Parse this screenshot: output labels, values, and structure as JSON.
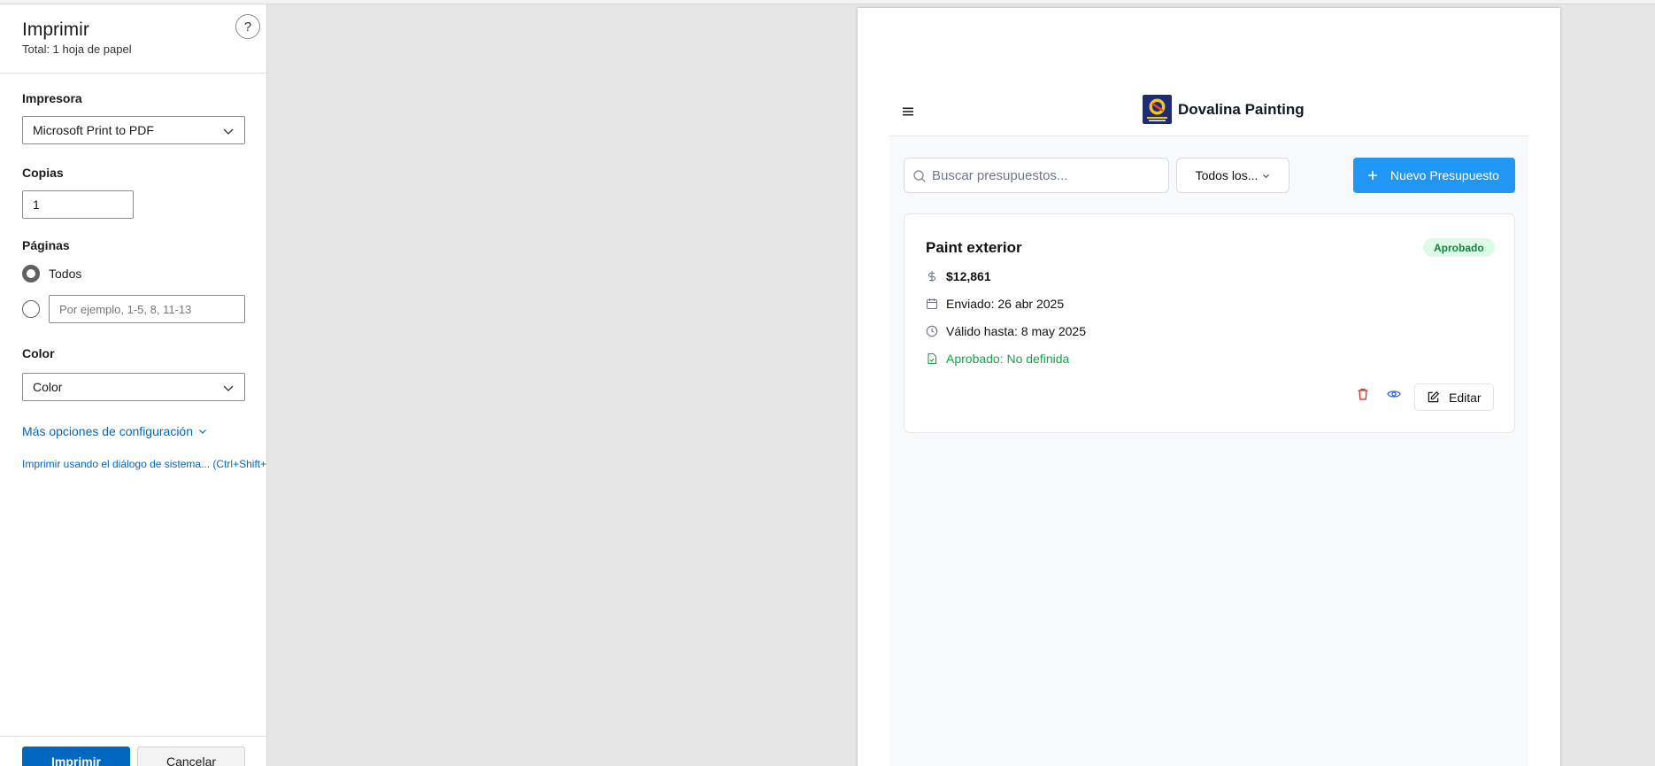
{
  "print_dialog": {
    "title": "Imprimir",
    "subtitle": "Total: 1 hoja de papel",
    "help_label": "?",
    "printer": {
      "label": "Impresora",
      "value": "Microsoft Print to PDF"
    },
    "copies": {
      "label": "Copias",
      "value": "1"
    },
    "pages": {
      "label": "Páginas",
      "option_all": "Todos",
      "range_placeholder": "Por ejemplo, 1-5, 8, 11-13"
    },
    "color": {
      "label": "Color",
      "value": "Color"
    },
    "more_settings": "Más opciones de configuración",
    "system_dialog": "Imprimir usando el diálogo de sistema... (Ctrl+Shift+P)",
    "print_button": "Imprimir",
    "cancel_button": "Cancelar"
  },
  "preview": {
    "brand": "Dovalina Painting",
    "search_placeholder": "Buscar presupuestos...",
    "filter_label": "Todos los...",
    "new_button": "Nuevo Presupuesto",
    "card": {
      "title": "Paint exterior",
      "status": "Aprobado",
      "price": "$12,861",
      "sent": "Enviado: 26 abr 2025",
      "valid": "Válido hasta: 8 may 2025",
      "approved": "Aprobado: No definida",
      "edit_label": "Editar"
    }
  },
  "colors": {
    "dialog_accent": "#0067c0",
    "app_primary": "#2196f3",
    "badge_bg": "#dcfce7",
    "badge_text": "#15803d",
    "delete_red": "#dc2626",
    "view_blue": "#2563eb",
    "approved_green": "#16a34a"
  },
  "icons": [
    "help-icon",
    "chevron-down-icon",
    "menu-icon",
    "search-icon",
    "plus-icon",
    "dollar-icon",
    "calendar-icon",
    "clock-icon",
    "file-check-icon",
    "trash-icon",
    "eye-icon",
    "edit-icon"
  ]
}
